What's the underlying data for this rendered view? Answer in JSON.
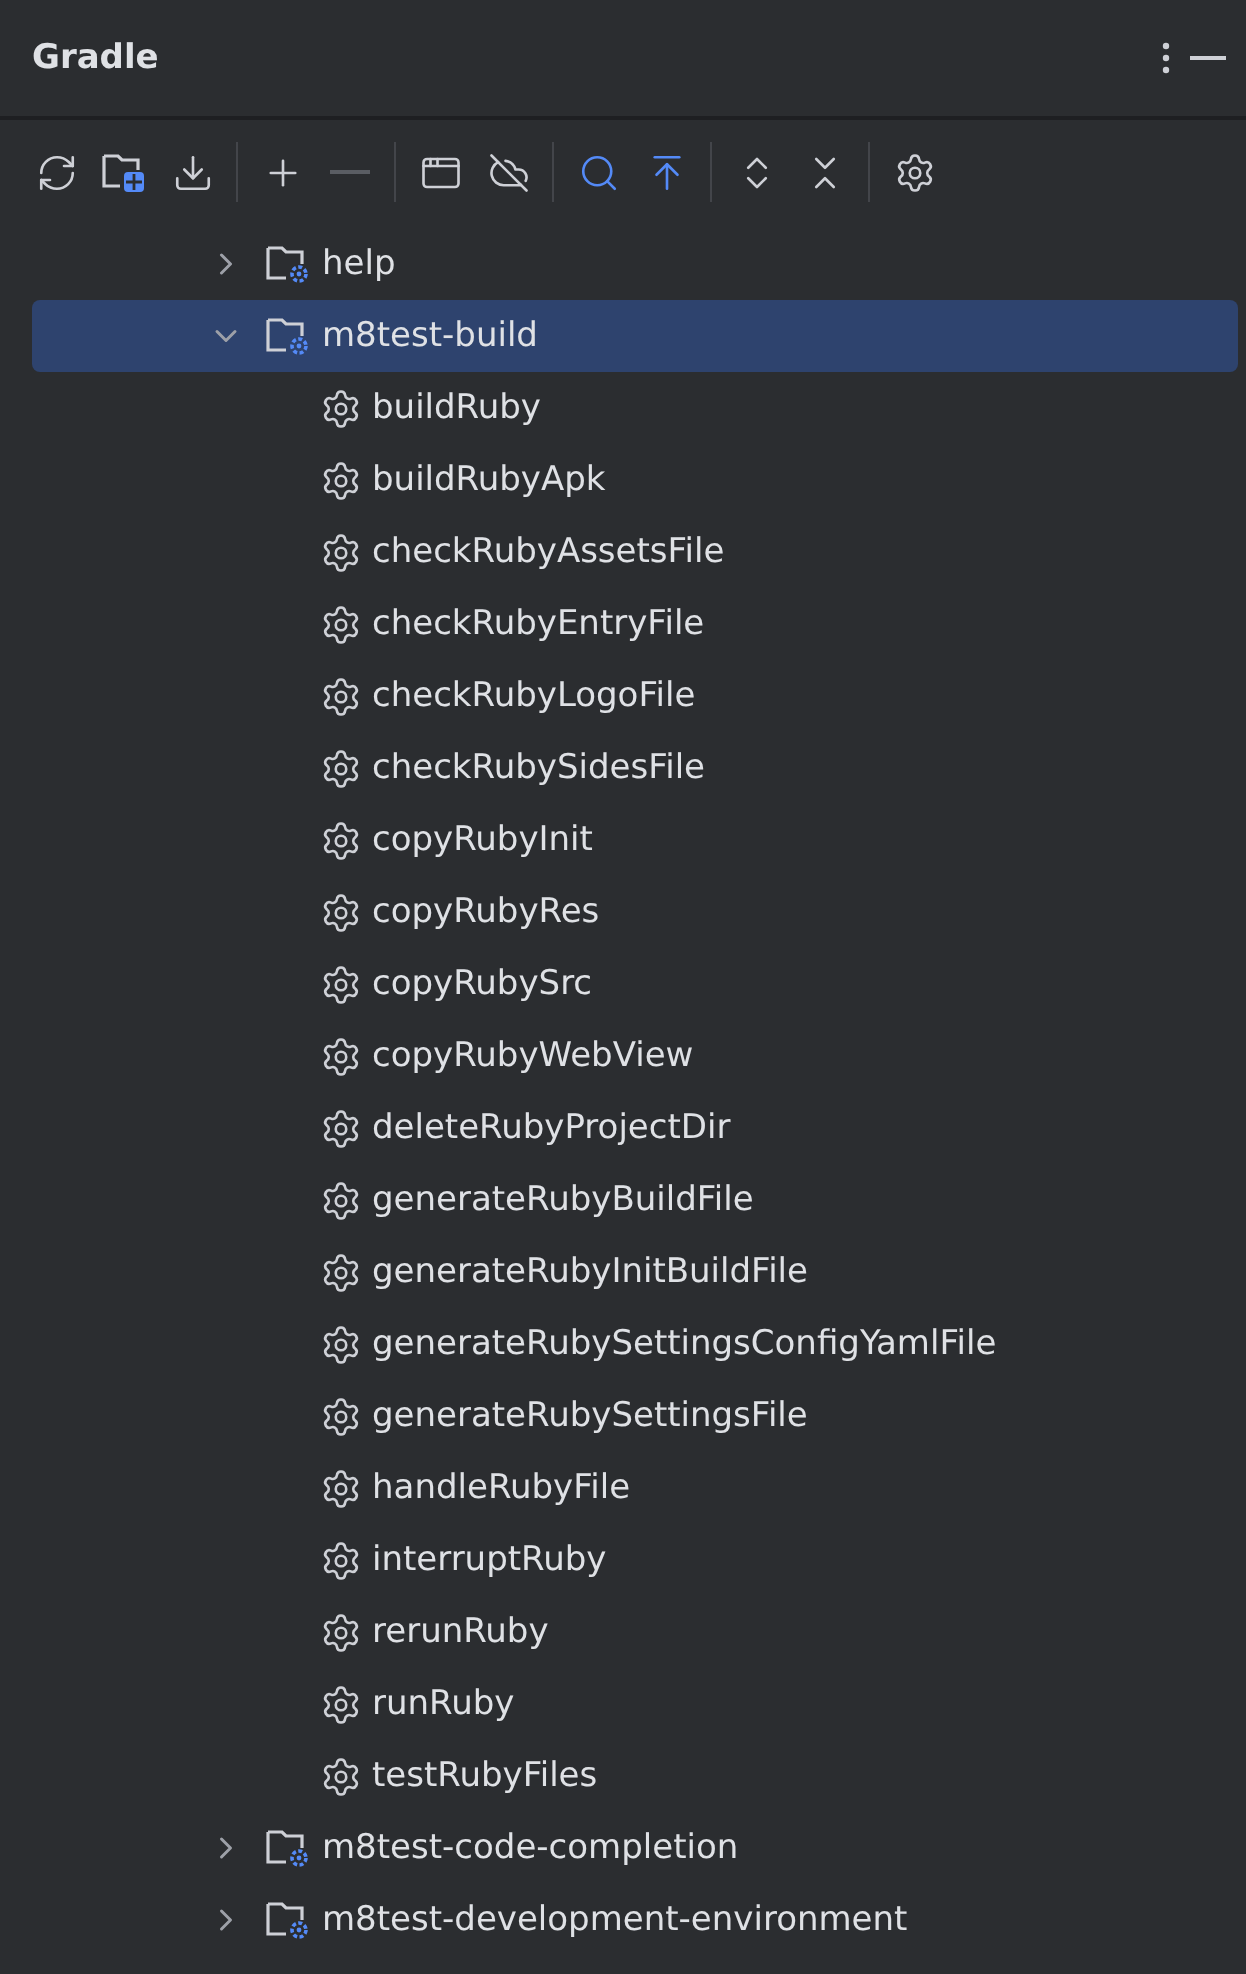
{
  "panel": {
    "title": "Gradle"
  },
  "toolbar": [
    {
      "kind": "reload",
      "disabled": false
    },
    {
      "kind": "link-project",
      "disabled": false
    },
    {
      "kind": "download",
      "disabled": false
    },
    {
      "kind": "separator"
    },
    {
      "kind": "add",
      "disabled": false
    },
    {
      "kind": "remove",
      "disabled": true
    },
    {
      "kind": "separator"
    },
    {
      "kind": "run",
      "disabled": false
    },
    {
      "kind": "offline",
      "disabled": false
    },
    {
      "kind": "separator"
    },
    {
      "kind": "analyze",
      "disabled": false
    },
    {
      "kind": "collapse-up",
      "disabled": false
    },
    {
      "kind": "separator"
    },
    {
      "kind": "expand-all",
      "disabled": false
    },
    {
      "kind": "collapse-all",
      "disabled": false
    },
    {
      "kind": "separator"
    },
    {
      "kind": "settings",
      "disabled": false
    }
  ],
  "tree": [
    {
      "label": "help",
      "kind": "module",
      "expanded": false,
      "selected": false
    },
    {
      "label": "m8test-build",
      "kind": "module",
      "expanded": true,
      "selected": true,
      "children": [
        {
          "label": "buildRuby",
          "kind": "task"
        },
        {
          "label": "buildRubyApk",
          "kind": "task"
        },
        {
          "label": "checkRubyAssetsFile",
          "kind": "task"
        },
        {
          "label": "checkRubyEntryFile",
          "kind": "task"
        },
        {
          "label": "checkRubyLogoFile",
          "kind": "task"
        },
        {
          "label": "checkRubySidesFile",
          "kind": "task"
        },
        {
          "label": "copyRubyInit",
          "kind": "task"
        },
        {
          "label": "copyRubyRes",
          "kind": "task"
        },
        {
          "label": "copyRubySrc",
          "kind": "task"
        },
        {
          "label": "copyRubyWebView",
          "kind": "task"
        },
        {
          "label": "deleteRubyProjectDir",
          "kind": "task"
        },
        {
          "label": "generateRubyBuildFile",
          "kind": "task"
        },
        {
          "label": "generateRubyInitBuildFile",
          "kind": "task"
        },
        {
          "label": "generateRubySettingsConfigYamlFile",
          "kind": "task"
        },
        {
          "label": "generateRubySettingsFile",
          "kind": "task"
        },
        {
          "label": "handleRubyFile",
          "kind": "task"
        },
        {
          "label": "interruptRuby",
          "kind": "task"
        },
        {
          "label": "rerunRuby",
          "kind": "task"
        },
        {
          "label": "runRuby",
          "kind": "task"
        },
        {
          "label": "testRubyFiles",
          "kind": "task"
        }
      ]
    },
    {
      "label": "m8test-code-completion",
      "kind": "module",
      "expanded": false,
      "selected": false
    },
    {
      "label": "m8test-development-environment",
      "kind": "module",
      "expanded": false,
      "selected": false
    }
  ]
}
